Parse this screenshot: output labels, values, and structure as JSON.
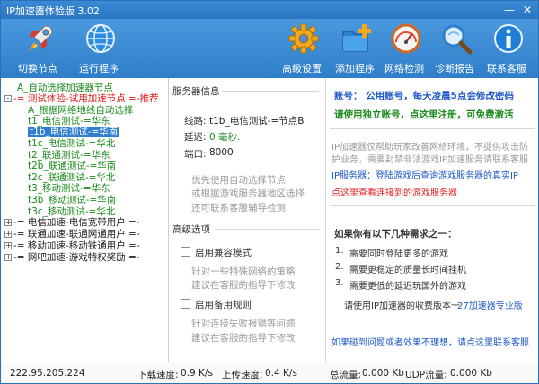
{
  "window": {
    "title": "IP加速器体验版 3.02",
    "minimize_glyph": "—",
    "close_glyph": "✕"
  },
  "toolbar": {
    "switch_node_label": "切换节点",
    "run_program_label": "运行程序",
    "advanced_settings_label": "高级设置",
    "add_program_label": "添加程序",
    "network_check_label": "网络检测",
    "diagnostic_report_label": "诊断报告",
    "contact_support_label": "联系客服"
  },
  "tree": {
    "items": [
      {
        "box": "",
        "text": "A_自动选择加速器节点",
        "color": "#1a8a1a"
      },
      {
        "box": "-",
        "text": "-= 测试体验-试用加速节点 =-推荐",
        "color": "#e02020"
      },
      {
        "box": "",
        "text": "A_根据网络地线自动选择",
        "color": "#1a8a1a"
      },
      {
        "box": "",
        "text": "t1_电信测试-=华东",
        "color": "#1a8a1a"
      },
      {
        "box": "",
        "text": "t1b_电信测试-=华南",
        "color": "#ffffff"
      },
      {
        "box": "",
        "text": "t1c_电信测试-=华北",
        "color": "#1a8a1a"
      },
      {
        "box": "",
        "text": "t2_联通测试-=华东",
        "color": "#1a8a1a"
      },
      {
        "box": "",
        "text": "t2b_联通测试-=华南",
        "color": "#1a8a1a"
      },
      {
        "box": "",
        "text": "t2c_联通测试-=华北",
        "color": "#1a8a1a"
      },
      {
        "box": "",
        "text": "t3_移动测试-=华东",
        "color": "#1a8a1a"
      },
      {
        "box": "",
        "text": "t3b_移动测试-=华南",
        "color": "#1a8a1a"
      },
      {
        "box": "",
        "text": "t3c_移动测试-=华北",
        "color": "#1a8a1a"
      },
      {
        "box": "+",
        "text": "-= 电信加速-电信宽带用户 =-",
        "color": "#222222"
      },
      {
        "box": "+",
        "text": "-= 联通加速-联通网通用户 =-",
        "color": "#222222"
      },
      {
        "box": "+",
        "text": "-= 移动加速-移动铁通用户 =-",
        "color": "#222222"
      },
      {
        "box": "+",
        "text": "-= 网吧加速-游戏特权奖励 =-",
        "color": "#222222"
      }
    ],
    "selected_index": 4
  },
  "server_info": {
    "section_title": "服务器信息",
    "route_label": "线路:",
    "route_value": "t1b_电信测试-=节点B",
    "latency_label": "延迟:",
    "latency_value": "0 毫秒.",
    "port_label": "端口:",
    "port_value": "8000",
    "hint_line1": "优先使用自动选择节点",
    "hint_line2": "或根据游戏服务器地区选择",
    "hint_line3": "还可联系客服辅导检测"
  },
  "advanced": {
    "section_title": "高级选项",
    "compat_label": "启用兼容模式",
    "compat_hint1": "针对一些特殊网络的策略",
    "compat_hint2": "建议在客服的指导下修改",
    "backup_label": "启用备用规则",
    "backup_hint1": "针对连接失败报错等问题",
    "backup_hint2": "建议在客服的指导下修改"
  },
  "account": {
    "line1": "账号：  公用账号，每天凌晨5点会修改密码",
    "line2": "请使用独立账号，点这里注册，可免费激活",
    "desc1": "IP加速器仅帮助玩家改善网络环境，不提供攻击防",
    "desc2": "护业务，需要封禁非法游戏IP加速服务请联系客服",
    "desc3": "IP服务器：登陆游戏后查询游戏服务器的真实IP",
    "desc4": "点这里查看连接到的游戏服务器",
    "needs_title": "如果你有以下几种需求之一：",
    "need1": "需要同时登陆更多的游戏",
    "need2": "需要更稳定的质量长时间挂机",
    "need3": "需要更低的延迟玩国外的游戏",
    "upgrade_text": "请使用IP加速器的收费版本一",
    "upgrade_link": "27加速器专业版",
    "feedback_link": "如果碰到问题或者效果不理想，请点这里联系客服"
  },
  "status": {
    "ip": "222.95.205.224",
    "download_label": "下载速度:",
    "download_value": "0.9 K/s",
    "upload_label": "上传速度:",
    "upload_value": "0.4 K/s",
    "total_label": "总流量:",
    "total_value": "0.000 Kb",
    "udp_label": "UDP流量:",
    "udp_value": "0.000 Kb"
  },
  "colors": {
    "accent_blue": "#2e7fd0",
    "green": "#1a8a1a",
    "red": "#e02020",
    "link_blue": "#1f58c9"
  }
}
